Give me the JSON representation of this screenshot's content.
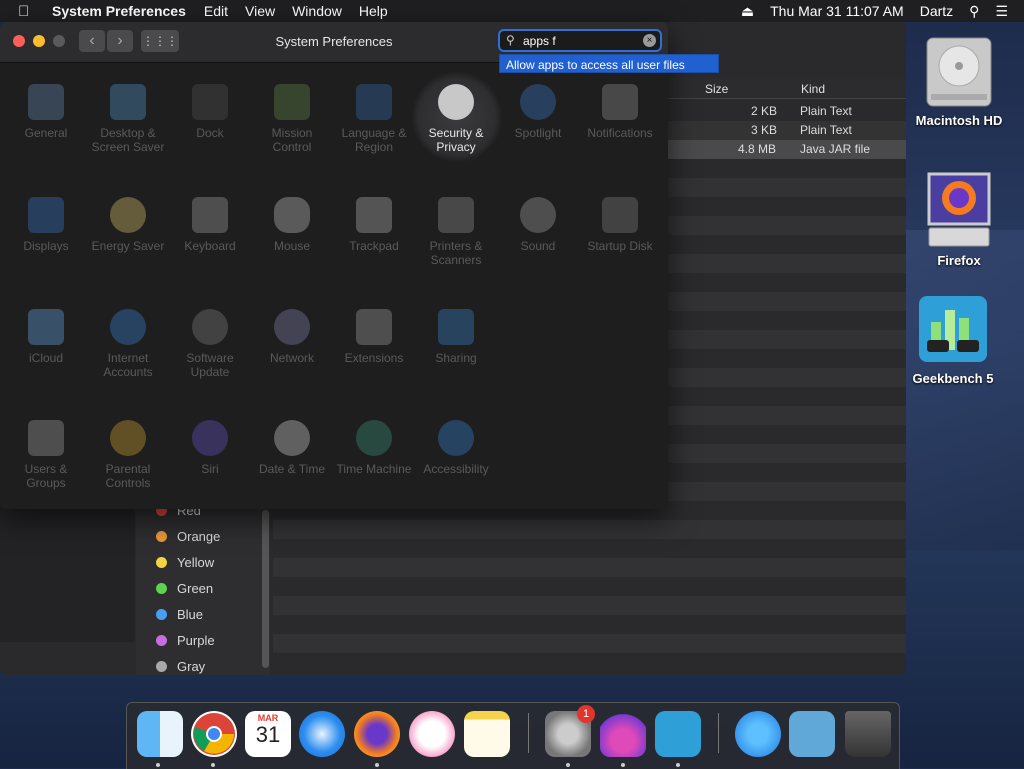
{
  "menubar": {
    "app_name": "System Preferences",
    "items": [
      "Edit",
      "View",
      "Window",
      "Help"
    ],
    "datetime": "Thu Mar 31  11:07 AM",
    "user": "Dartz"
  },
  "sysprefs": {
    "window_title": "System Preferences",
    "search_value": "apps f",
    "suggestion": "Allow apps to access all user files",
    "panes": [
      {
        "label": "General",
        "icon": "general-icon",
        "color": "#6a8fb8"
      },
      {
        "label": "Desktop & Screen Saver",
        "icon": "desktop-icon",
        "color": "#5a9fd4"
      },
      {
        "label": "Dock",
        "icon": "dock-icon",
        "color": "#333"
      },
      {
        "label": "Mission Control",
        "icon": "mission-control-icon",
        "color": "#6a8e4a"
      },
      {
        "label": "Language & Region",
        "icon": "language-icon",
        "color": "#3a6fb8"
      },
      {
        "label": "Security & Privacy",
        "icon": "security-house-icon",
        "color": "#bbb"
      },
      {
        "label": "Spotlight",
        "icon": "spotlight-icon",
        "color": "#3b7fd1"
      },
      {
        "label": "Notifications",
        "icon": "notifications-icon",
        "color": "#999"
      },
      {
        "label": "Displays",
        "icon": "displays-icon",
        "color": "#3a7ad0"
      },
      {
        "label": "Energy Saver",
        "icon": "energy-icon",
        "color": "#e8d070"
      },
      {
        "label": "Keyboard",
        "icon": "keyboard-icon",
        "color": "#aaa"
      },
      {
        "label": "Mouse",
        "icon": "mouse-icon",
        "color": "#ccc"
      },
      {
        "label": "Trackpad",
        "icon": "trackpad-icon",
        "color": "#bbb"
      },
      {
        "label": "Printers & Scanners",
        "icon": "printer-icon",
        "color": "#999"
      },
      {
        "label": "Sound",
        "icon": "sound-icon",
        "color": "#aaa"
      },
      {
        "label": "Startup Disk",
        "icon": "disk-icon",
        "color": "#888"
      },
      {
        "label": "iCloud",
        "icon": "icloud-icon",
        "color": "#6ab0f0"
      },
      {
        "label": "Internet Accounts",
        "icon": "at-icon",
        "color": "#3b8ae0"
      },
      {
        "label": "Software Update",
        "icon": "gear-icon",
        "color": "#888"
      },
      {
        "label": "Network",
        "icon": "network-icon",
        "color": "#8a8ab8"
      },
      {
        "label": "Extensions",
        "icon": "puzzle-icon",
        "color": "#aaa"
      },
      {
        "label": "Sharing",
        "icon": "sharing-icon",
        "color": "#3a8ad0"
      },
      {
        "label": "Users & Groups",
        "icon": "users-icon",
        "color": "#aaa"
      },
      {
        "label": "Parental Controls",
        "icon": "parental-icon",
        "color": "#e0b030"
      },
      {
        "label": "Siri",
        "icon": "siri-icon",
        "color": "#6a5ad0"
      },
      {
        "label": "Date & Time",
        "icon": "clock-icon",
        "color": "#ddd"
      },
      {
        "label": "Time Machine",
        "icon": "time-machine-icon",
        "color": "#3a9a7a"
      },
      {
        "label": "Accessibility",
        "icon": "accessibility-icon",
        "color": "#3a8ae0"
      }
    ]
  },
  "finder": {
    "columns": {
      "size": "Size",
      "kind": "Kind"
    },
    "rows": [
      {
        "size": "2 KB",
        "kind": "Plain Text"
      },
      {
        "size": "3 KB",
        "kind": "Plain Text"
      },
      {
        "size": "4.8 MB",
        "kind": "Java JAR file"
      }
    ],
    "tags": [
      {
        "name": "Red",
        "color": "#e0443e"
      },
      {
        "name": "Orange",
        "color": "#e89a3a"
      },
      {
        "name": "Yellow",
        "color": "#f1d544"
      },
      {
        "name": "Green",
        "color": "#5fd24f"
      },
      {
        "name": "Blue",
        "color": "#4a9ef0"
      },
      {
        "name": "Purple",
        "color": "#c46ee0"
      },
      {
        "name": "Gray",
        "color": "#a8a8a8"
      }
    ]
  },
  "desktop": {
    "icons": [
      {
        "label": "Macintosh HD"
      },
      {
        "label": "Firefox"
      },
      {
        "label": "Geekbench 5"
      }
    ]
  },
  "dock": {
    "items": [
      {
        "name": "finder-icon"
      },
      {
        "name": "chrome-icon"
      },
      {
        "name": "calendar-icon",
        "month": "MAR",
        "day": "31"
      },
      {
        "name": "safari-icon"
      },
      {
        "name": "firefox-icon"
      },
      {
        "name": "itunes-icon"
      },
      {
        "name": "notes-icon"
      },
      {
        "name": "system-preferences-icon",
        "badge": "1"
      },
      {
        "name": "installer-icon"
      },
      {
        "name": "geekbench-icon"
      },
      {
        "name": "app-store-icon"
      },
      {
        "name": "downloads-folder-icon"
      },
      {
        "name": "trash-icon"
      }
    ]
  }
}
